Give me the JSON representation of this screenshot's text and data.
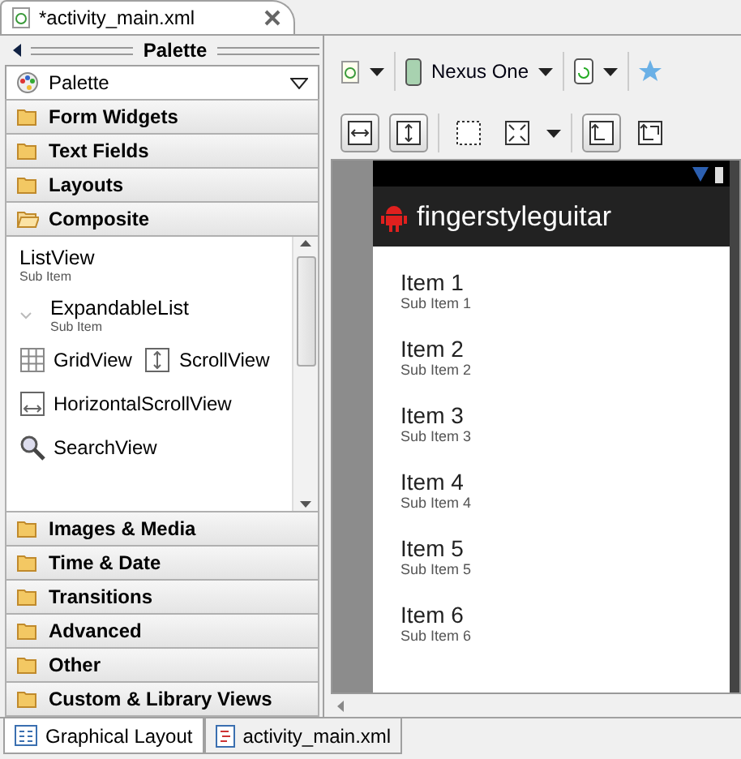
{
  "editor_tab": {
    "title": "*activity_main.xml"
  },
  "palette": {
    "title": "Palette",
    "selector": "Palette",
    "categories": [
      {
        "label": "Form Widgets",
        "expanded": false
      },
      {
        "label": "Text Fields",
        "expanded": false
      },
      {
        "label": "Layouts",
        "expanded": false
      },
      {
        "label": "Composite",
        "expanded": true
      },
      {
        "label": "Images & Media",
        "expanded": false
      },
      {
        "label": "Time & Date",
        "expanded": false
      },
      {
        "label": "Transitions",
        "expanded": false
      },
      {
        "label": "Advanced",
        "expanded": false
      },
      {
        "label": "Other",
        "expanded": false
      },
      {
        "label": "Custom & Library Views",
        "expanded": false
      }
    ],
    "widgets": [
      {
        "kind": "list",
        "label": "ListView",
        "sublabel": "Sub Item"
      },
      {
        "kind": "expandable",
        "label": "ExpandableList",
        "sublabel": "Sub Item"
      },
      {
        "kind": "icons",
        "items": [
          {
            "kind": "grid",
            "label": "GridView"
          },
          {
            "kind": "vscroll",
            "label": "ScrollView"
          }
        ]
      },
      {
        "kind": "icons",
        "items": [
          {
            "kind": "hscroll",
            "label": "HorizontalScrollView"
          }
        ]
      },
      {
        "kind": "icons",
        "items": [
          {
            "kind": "search",
            "label": "SearchView"
          }
        ]
      }
    ]
  },
  "toolbar": {
    "device": "Nexus One",
    "view_buttons": [
      {
        "kind": "fill-width",
        "selected": true
      },
      {
        "kind": "fill-height",
        "selected": true
      },
      {
        "kind": "zoom-box",
        "selected": false
      },
      {
        "kind": "zoom-fit",
        "selected": false
      },
      {
        "kind": "layout-a",
        "selected": true
      },
      {
        "kind": "layout-b",
        "selected": false
      }
    ]
  },
  "phone": {
    "app_title": "fingerstyleguitar",
    "items": [
      {
        "title": "Item 1",
        "subtitle": "Sub Item 1"
      },
      {
        "title": "Item 2",
        "subtitle": "Sub Item 2"
      },
      {
        "title": "Item 3",
        "subtitle": "Sub Item 3"
      },
      {
        "title": "Item 4",
        "subtitle": "Sub Item 4"
      },
      {
        "title": "Item 5",
        "subtitle": "Sub Item 5"
      },
      {
        "title": "Item 6",
        "subtitle": "Sub Item 6"
      }
    ]
  },
  "bottom_tabs": [
    {
      "label": "Graphical Layout",
      "selected": true
    },
    {
      "label": "activity_main.xml",
      "selected": false
    }
  ]
}
